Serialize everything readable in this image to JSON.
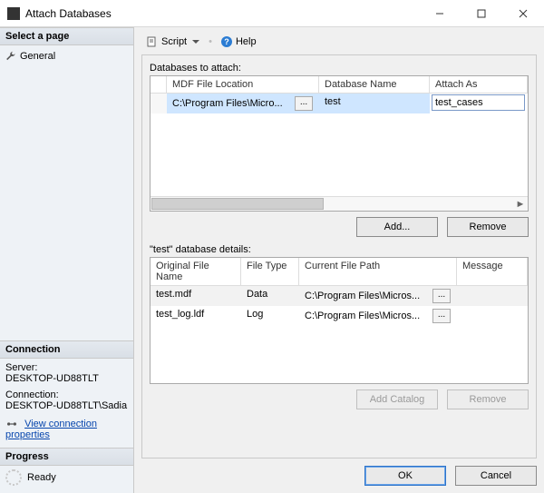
{
  "window": {
    "title": "Attach Databases"
  },
  "sidebar": {
    "select_page": "Select a page",
    "general": "General",
    "connection_head": "Connection",
    "server_label": "Server:",
    "server_value": "DESKTOP-UD88TLT",
    "connection_label": "Connection:",
    "connection_value": "DESKTOP-UD88TLT\\Sadia",
    "view_props": "View connection properties",
    "progress_head": "Progress",
    "progress_value": "Ready"
  },
  "toolbar": {
    "script_label": "Script",
    "help_label": "Help"
  },
  "attach": {
    "group_label": "Databases to attach:",
    "headers": {
      "mdf": "MDF File Location",
      "db": "Database Name",
      "as": "Attach As"
    },
    "row": {
      "mdf": "C:\\Program Files\\Micro...",
      "db": "test",
      "as": "test_cases"
    },
    "add_btn": "Add...",
    "remove_btn": "Remove"
  },
  "details": {
    "label_prefix": "\"test\" database details:",
    "headers": {
      "fname": "Original File Name",
      "ftype": "File Type",
      "fpath": "Current File Path",
      "msg": "Message"
    },
    "rows": [
      {
        "fname": "test.mdf",
        "ftype": "Data",
        "fpath": "C:\\Program Files\\Micros..."
      },
      {
        "fname": "test_log.ldf",
        "ftype": "Log",
        "fpath": "C:\\Program Files\\Micros..."
      }
    ],
    "add_catalog_btn": "Add Catalog",
    "remove_btn": "Remove"
  },
  "footer": {
    "ok": "OK",
    "cancel": "Cancel"
  },
  "ellipsis": "..."
}
